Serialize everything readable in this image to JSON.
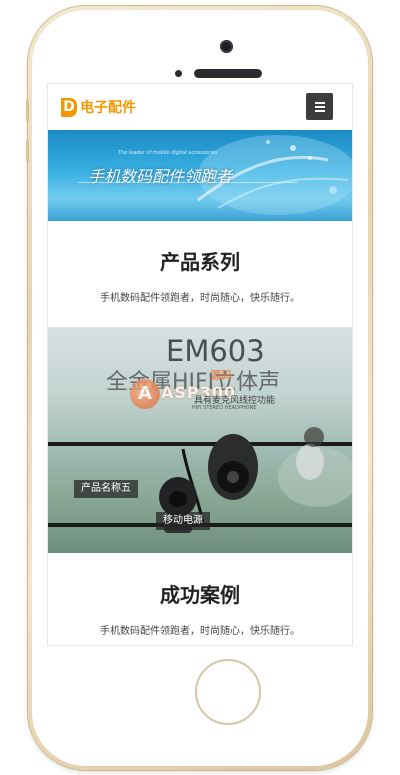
{
  "header": {
    "logo_mark": "D",
    "logo_text": "电子配件",
    "brand_color": "#f39800",
    "menu_icon": "hamburger-menu-icon"
  },
  "banner": {
    "title": "手机数码配件领跑者",
    "subtitle": "The leader of mobile digital accessories"
  },
  "sections": {
    "products": {
      "title": "产品系列",
      "description": "手机数码配件领跑者，时尚随心，快乐随行。"
    },
    "cases": {
      "title": "成功案例",
      "description": "手机数码配件领跑者，时尚随心，快乐随行。"
    }
  },
  "product_image": {
    "model": "EM603",
    "headline": "全金属HIFI立体声",
    "feature": "具有麦克风线控功能",
    "feature_en": "HIFI STEREO HEADPHONE",
    "watermark": "ASP300",
    "watermark_mark": "A",
    "watermark_cn": "源码",
    "label_name": "产品名称五",
    "label_power": "移动电源"
  }
}
